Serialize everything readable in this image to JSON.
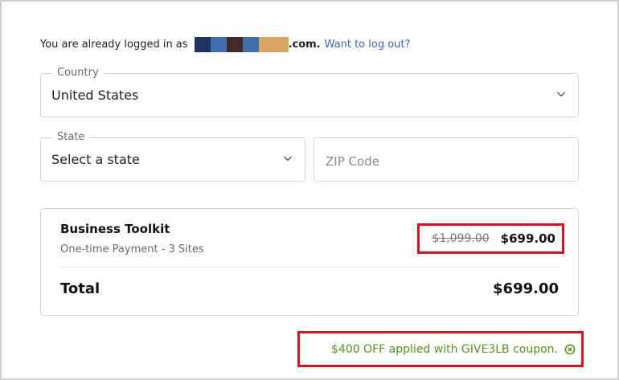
{
  "login": {
    "prefix": "You are already logged in as",
    "domain_suffix": ".com.",
    "logout_link": "Want to log out?",
    "redaction_colors": [
      "#1e3462",
      "#3d6fae",
      "#452a26",
      "#3d6fae",
      "#d9a661"
    ]
  },
  "country": {
    "label": "Country",
    "value": "United States",
    "icon": "chevron-down-icon"
  },
  "state": {
    "label": "State",
    "value": "Select a state",
    "icon": "chevron-down-icon"
  },
  "zip": {
    "placeholder": "ZIP Code"
  },
  "order": {
    "product_name": "Business Toolkit",
    "product_desc": "One-time Payment - 3 Sites",
    "original_price": "$1,099.00",
    "price": "$699.00",
    "total_label": "Total",
    "total_value": "$699.00"
  },
  "coupon": {
    "message": "$400 OFF applied with GIVE3LB coupon.",
    "icon": "remove-coupon-icon",
    "color": "#4f9a16"
  },
  "colors": {
    "highlight": "#e0131b",
    "link": "#3b68b6",
    "success": "#4f9a16"
  }
}
